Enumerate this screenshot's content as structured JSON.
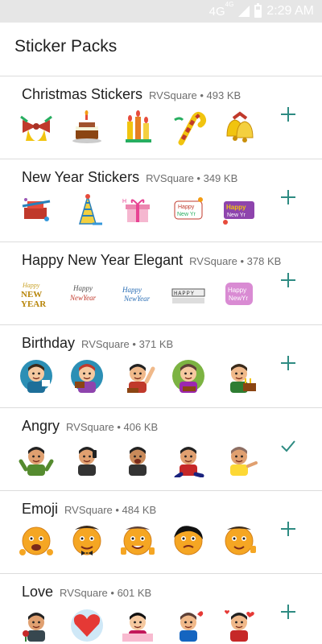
{
  "status": {
    "network": "4G",
    "network_sup": "4G",
    "time": "2:29 AM"
  },
  "title": "Sticker Packs",
  "colors": {
    "accent": "#2e8b82",
    "divider": "#dcdcdc",
    "status_bar": "#e6e6e6"
  },
  "packs": [
    {
      "name": "Christmas Stickers",
      "meta": "RVSquare • 493 KB",
      "action": "add",
      "stickers": [
        "bells-bow-icon",
        "cake-icon",
        "candles-icon",
        "candy-cane-icon",
        "golden-bells-icon"
      ]
    },
    {
      "name": "New Year Stickers",
      "meta": "RVSquare • 349 KB",
      "action": "add",
      "stickers": [
        "party-hat-icon",
        "cone-hat-icon",
        "gift-box-icon",
        "greeting-text-icon",
        "happy-new-year-icon"
      ]
    },
    {
      "name": "Happy New Year Elegant",
      "meta": "RVSquare • 378 KB",
      "action": "add",
      "stickers": [
        "new-year-text-icon",
        "happy-script-icon",
        "script-text-icon",
        "banner-text-icon",
        "pink-badge-icon"
      ]
    },
    {
      "name": "Birthday",
      "meta": "RVSquare • 371 KB",
      "action": "add",
      "stickers": [
        "man-cake-icon",
        "woman-cake-icon",
        "man-waving-icon",
        "man-green-icon",
        "man-candles-icon"
      ]
    },
    {
      "name": "Angry",
      "meta": "RVSquare • 406 KB",
      "action": "added",
      "stickers": [
        "angry-man-green-icon",
        "angry-man-phone-icon",
        "angry-man-yelling-icon",
        "angry-man-stomping-icon",
        "angry-man-pointing-icon"
      ]
    },
    {
      "name": "Emoji",
      "meta": "RVSquare • 484 KB",
      "action": "add",
      "stickers": [
        "emoji-shout-icon",
        "emoji-bowtie-icon",
        "emoji-thumbs-icon",
        "emoji-dark-hair-icon",
        "emoji-wink-icon"
      ]
    },
    {
      "name": "Love",
      "meta": "RVSquare • 601 KB",
      "action": "add",
      "stickers": [
        "love-rose-icon",
        "love-heart-icon",
        "love-couple-icon",
        "love-boy-icon",
        "love-hearts-icon"
      ]
    }
  ]
}
